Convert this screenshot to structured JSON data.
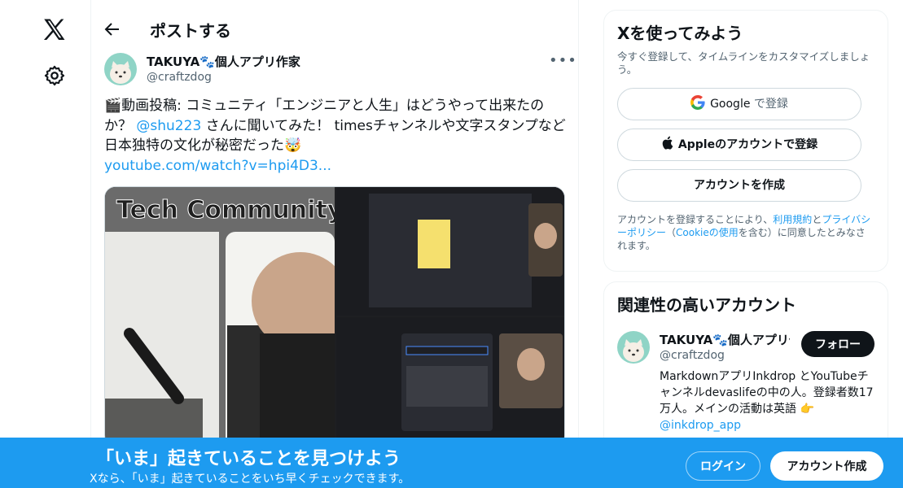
{
  "header": {
    "title": "ポストする"
  },
  "post": {
    "author_name": "TAKUYA🐾個人アプリ作家",
    "author_handle": "@craftzdog",
    "text_1": "🎬動画投稿: コミュニティ「エンジニアと人生」はどうやって出来たのか？ ",
    "mention": "@shu223",
    "text_2": " さんに聞いてみた！ timesチャンネルや文字スタンプなど日本独特の文化が秘密だった🤯",
    "link": "youtube.com/watch?v=hpi4D3...",
    "media_caption": "Tech Community"
  },
  "signup": {
    "title": "Xを使ってみよう",
    "subtitle": "今すぐ登録して、タイムラインをカスタマイズしましょう。",
    "google_brand": "Google",
    "google_suffix": " で登録",
    "apple": "Appleのアカウントで登録",
    "create": "アカウントを作成",
    "terms_1": "アカウントを登録することにより、",
    "terms_link_1": "利用規約",
    "terms_2": "と",
    "terms_link_2": "プライバシーポリシー",
    "terms_3": "（",
    "terms_link_3": "Cookieの使用",
    "terms_4": "を含む）に同意したとみなされます。"
  },
  "related": {
    "title": "関連性の高いアカウント",
    "name": "TAKUYA🐾個人アプリ作家",
    "handle": "@craftzdog",
    "follow": "フォロー",
    "bio": "MarkdownアプリInkdrop とYouTubeチャンネルdevaslifeの中の人。登録者数17万人。メインの活動は英語 👉",
    "bio_link": "@inkdrop_app"
  },
  "banner": {
    "title": "「いま」起きていることを見つけよう",
    "subtitle": "Xなら、「いま」起きていることをいち早くチェックできます。",
    "login": "ログイン",
    "signup": "アカウント作成"
  },
  "colors": {
    "accent": "#1d9bf0",
    "text": "#0f1419",
    "muted": "#536471"
  }
}
